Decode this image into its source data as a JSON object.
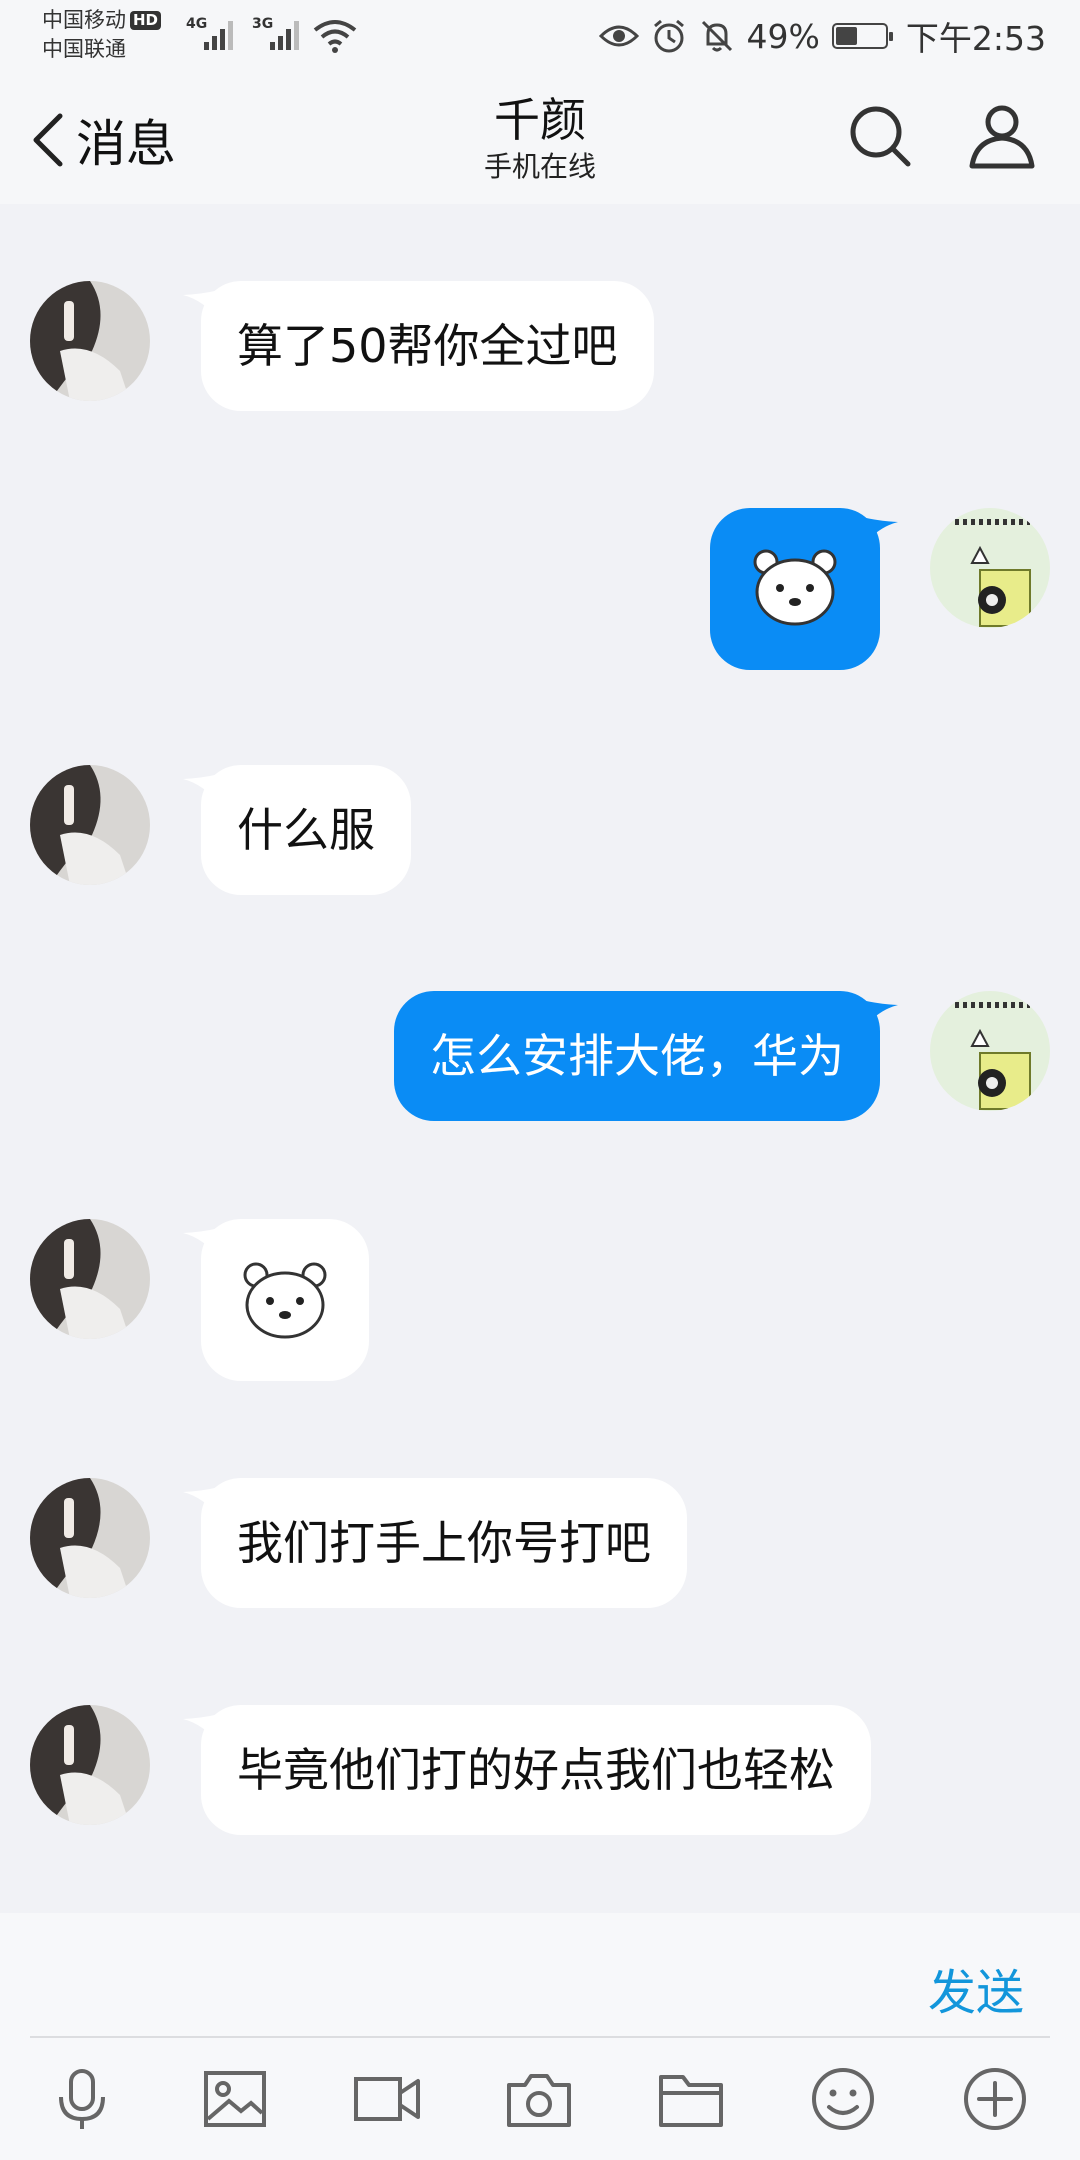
{
  "status_bar": {
    "carrier_1": "中国移动",
    "carrier_1_badge": "HD",
    "carrier_2": "中国联通",
    "network_1": "4G",
    "network_2": "3G",
    "battery_text": "49%",
    "battery_level": 0.49,
    "time": "下午2:53",
    "icons": [
      "eye-icon",
      "alarm-icon",
      "mute-icon",
      "wifi-icon",
      "signal-icon"
    ]
  },
  "header": {
    "back_label": "消息",
    "title": "千颜",
    "subtitle": "手机在线",
    "icons": [
      "back-chevron-icon",
      "search-icon",
      "profile-icon"
    ]
  },
  "messages": [
    {
      "side": "in",
      "type": "text",
      "text": "算了50帮你全过吧"
    },
    {
      "side": "out",
      "type": "sticker",
      "sticker": "polar-bear-sticker"
    },
    {
      "side": "in",
      "type": "text",
      "text": "什么服"
    },
    {
      "side": "out",
      "type": "text",
      "text": "怎么安排大佬，华为"
    },
    {
      "side": "in",
      "type": "sticker",
      "sticker": "polar-bear-sticker"
    },
    {
      "side": "in",
      "type": "text",
      "text": "我们打手上你号打吧"
    },
    {
      "side": "in",
      "type": "text",
      "text": "毕竟他们打的好点我们也轻松"
    }
  ],
  "input": {
    "send_label": "发送",
    "toolbar": [
      "microphone-icon",
      "image-icon",
      "video-icon",
      "camera-icon",
      "folder-icon",
      "emoji-icon",
      "plus-icon"
    ]
  },
  "colors": {
    "background": "#f1f2f6",
    "outgoing_bubble": "#0a8cf5",
    "incoming_bubble": "#ffffff",
    "send": "#1296db"
  }
}
